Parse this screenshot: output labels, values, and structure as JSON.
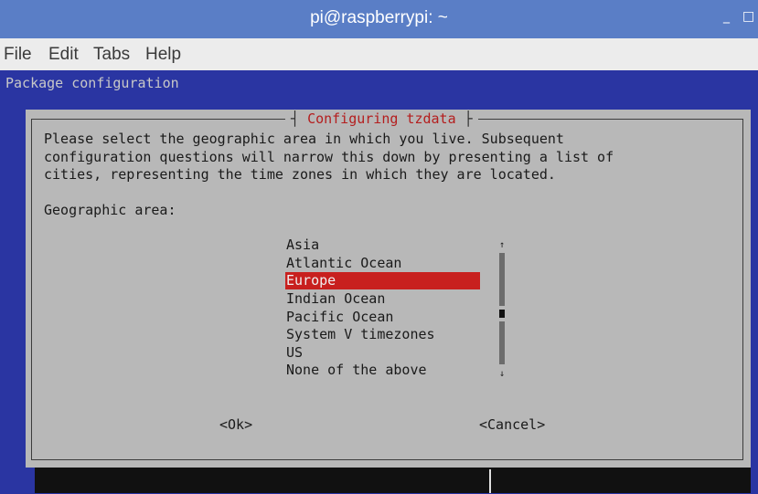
{
  "window": {
    "title": "pi@raspberrypi: ~",
    "minimize_glyph": "_",
    "maximize_glyph": "□"
  },
  "menubar": {
    "items": [
      "File",
      "Edit",
      "Tabs",
      "Help"
    ]
  },
  "terminal": {
    "header": "Package configuration"
  },
  "dialog": {
    "title": "Configuring tzdata",
    "title_sep_left": "┤",
    "title_sep_right": "├",
    "description_lines": [
      "Please select the geographic area in which you live. Subsequent",
      "configuration questions will narrow this down by presenting a list of",
      "cities, representing the time zones in which they are located."
    ],
    "prompt": "Geographic area:",
    "options": [
      "Asia",
      "Atlantic Ocean",
      "Europe",
      "Indian Ocean",
      "Pacific Ocean",
      "System V timezones",
      "US",
      "None of the above"
    ],
    "selected_index": 2,
    "ok_label": "<Ok>",
    "cancel_label": "<Cancel>"
  },
  "icons": {
    "scroll_up": "↑",
    "scroll_down": "↓"
  },
  "colors": {
    "titlebar": "#5a7ec6",
    "terminal_bg": "#2a35a2",
    "dialog_bg": "#b8b8b8",
    "selection": "#c8201e",
    "title_text": "#b41e1e"
  }
}
